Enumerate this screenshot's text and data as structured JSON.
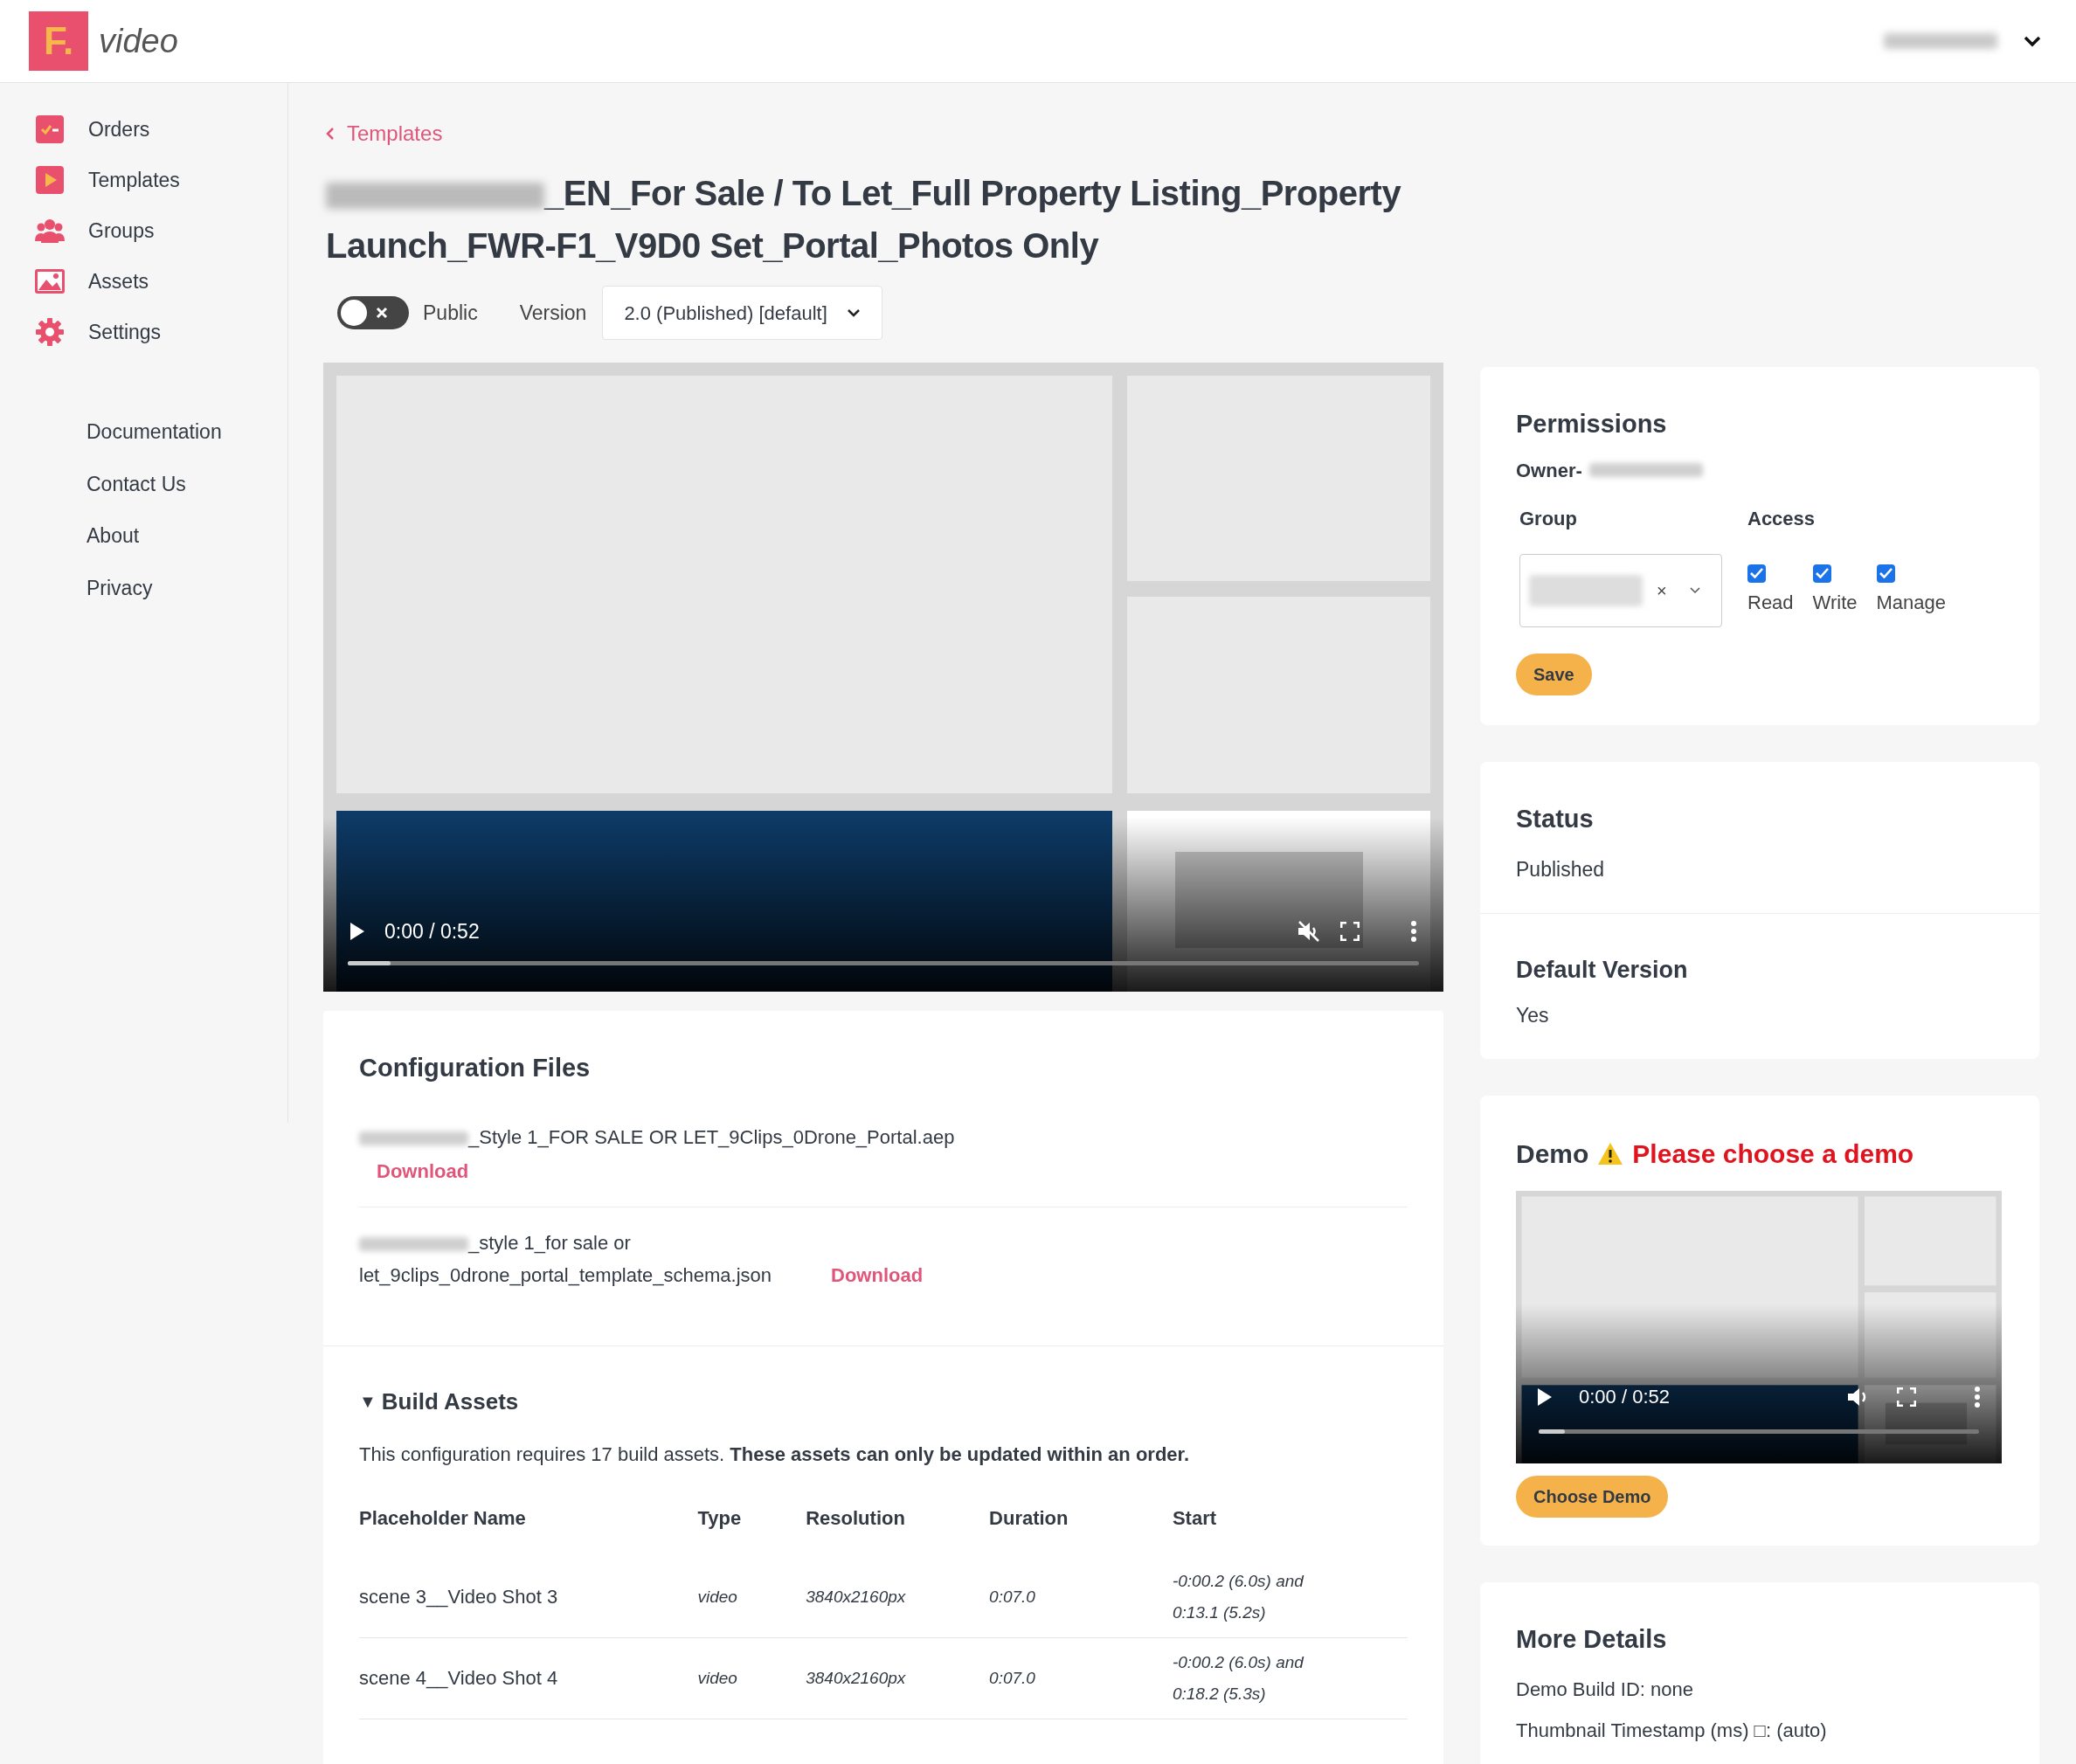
{
  "header": {
    "logo_letter": "F.",
    "app_name": "video"
  },
  "sidebar": {
    "items": [
      {
        "label": "Orders"
      },
      {
        "label": "Templates"
      },
      {
        "label": "Groups"
      },
      {
        "label": "Assets"
      },
      {
        "label": "Settings"
      }
    ],
    "links": [
      "Documentation",
      "Contact Us",
      "About",
      "Privacy"
    ]
  },
  "breadcrumb": {
    "label": "Templates"
  },
  "title": "_EN_For Sale / To Let_Full Property Listing_Property Launch_FWR-F1_V9D0 Set_Portal_Photos Only",
  "publish": {
    "toggle_label": "Public",
    "on": false,
    "version_label": "Version",
    "version_value": "2.0 (Published) [default]"
  },
  "player": {
    "time": "0:00 / 0:52",
    "muted": true,
    "level": 0.04
  },
  "config_files": {
    "title": "Configuration Files",
    "files": [
      {
        "kind": "stacked",
        "name": "_Style 1_FOR SALE OR LET_9Clips_0Drone_Portal.aep",
        "link": "Download"
      },
      {
        "kind": "inline",
        "name": "_style 1_for sale or let_9clips_0drone_portal_template_schema.json",
        "link": "Download"
      }
    ]
  },
  "build_assets": {
    "expanded": true,
    "caret": "▼",
    "title": "Build Assets",
    "description": "This configuration requires 17 build assets. **These assets can only be updated within an order.**",
    "columns": [
      "Placeholder Name",
      "Type",
      "Resolution",
      "Duration",
      "Start"
    ],
    "rows": [
      [
        "scene 3__Video Shot 3",
        "video",
        "3840x2160px",
        "0:07.0",
        "-0:00.2 (6.0s) and 0:13.1 (5.2s)"
      ],
      [
        "scene 4__Video Shot 4",
        "video",
        "3840x2160px",
        "0:07.0",
        "-0:00.2 (6.0s) and 0:18.2 (5.3s)"
      ]
    ]
  },
  "permissions": {
    "title": "Permissions",
    "owner_label": "Owner-",
    "group_label": "Group",
    "clear": "×",
    "access_label": "Access",
    "access": [
      {
        "label": "Read",
        "checked": true
      },
      {
        "label": "Write",
        "checked": true
      },
      {
        "label": "Manage",
        "checked": true
      }
    ],
    "save": "Save"
  },
  "status": {
    "title": "Status",
    "value": "Published"
  },
  "default_version": {
    "title": "Default Version",
    "value": "Yes"
  },
  "demo": {
    "title": "Demo",
    "warning": "Please choose a demo",
    "player": {
      "time": "0:00 / 0:52",
      "muted": false,
      "level": 0.06
    },
    "button": "Choose Demo"
  },
  "more_details": {
    "title": "More Details",
    "lines": [
      "Demo Build ID: none",
      "Thumbnail Timestamp (ms) □: (auto)"
    ]
  }
}
